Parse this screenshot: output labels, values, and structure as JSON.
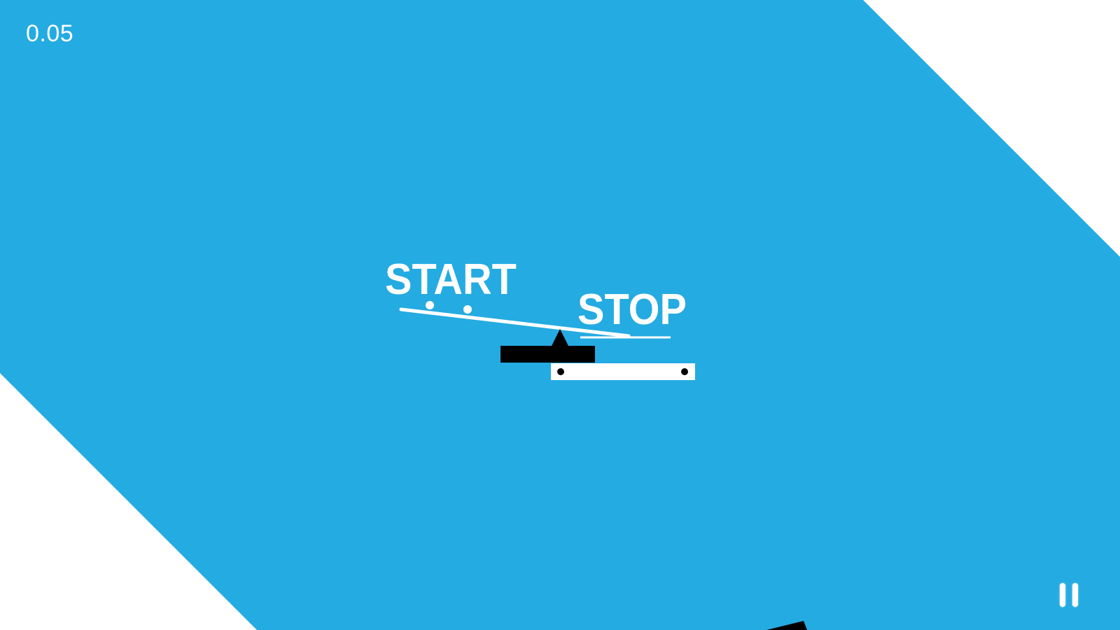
{
  "hud": {
    "timer": "0.05",
    "pause_icon": "pause-icon"
  },
  "scene": {
    "start_label": "START",
    "stop_label": "STOP"
  },
  "colors": {
    "sky": "#24abe2",
    "corner": "#ffffff",
    "blocks": "#000000",
    "text": "#ffffff"
  }
}
